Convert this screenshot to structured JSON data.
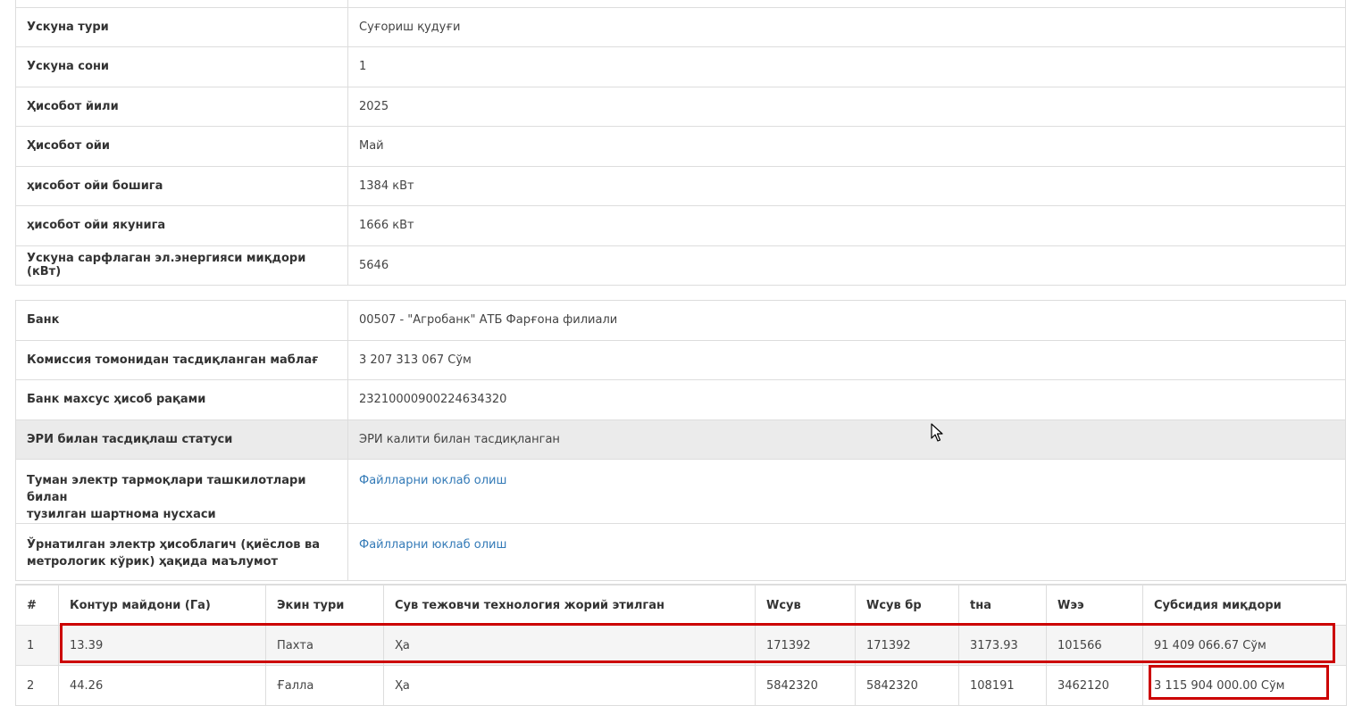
{
  "device_info": [
    {
      "label": "",
      "value": ""
    },
    {
      "label": "Ускуна тури",
      "value": "Суғориш қудуғи"
    },
    {
      "label": "Ускуна сони",
      "value": "1"
    },
    {
      "label": "Ҳисобот йили",
      "value": "2025"
    },
    {
      "label": "Ҳисобот ойи",
      "value": "Май"
    },
    {
      "label": "ҳисобот ойи бошига",
      "value": "1384 кВт"
    },
    {
      "label": "ҳисобот ойи якунига",
      "value": "1666 кВт"
    },
    {
      "label": "Ускуна сарфлаган эл.энергияси миқдори (кВт)",
      "value": "5646"
    }
  ],
  "bank_info": {
    "bank": {
      "label": "Банк",
      "value": "00507 - \"Агробанк\" АТБ Фарғона филиали"
    },
    "approved_amount": {
      "label": "Комиссия томонидан тасдиқланган маблағ",
      "value": "3 207 313 067 Сўм"
    },
    "account": {
      "label": "Банк махсус ҳисоб рақами",
      "value": "23210000900224634320"
    },
    "eri_status": {
      "label": "ЭРИ билан тасдиқлаш статуси",
      "value": "ЭРИ калити билан тасдиқланган"
    },
    "contract": {
      "label_line1": "Туман электр тармоқлари ташкилотлари билан",
      "label_line2": "тузилган шартнома нусхаси",
      "link": "Файлларни юклаб олиш"
    },
    "meter": {
      "label_line1": "Ўрнатилган электр ҳисоблагич (қиёслов ва",
      "label_line2": "метрологик кўрик) ҳақида маълумот",
      "link": "Файлларни юклаб олиш"
    }
  },
  "subsidy_table": {
    "headers": [
      "#",
      "Контур майдони (Га)",
      "Экин тури",
      "Сув тежовчи технология жорий этилган",
      "Wсув",
      "Wсув бр",
      "tна",
      "Wээ",
      "Субсидия миқдори"
    ],
    "rows": [
      [
        "1",
        "13.39",
        "Пахта",
        "Ҳа",
        "171392",
        "171392",
        "3173.93",
        "101566",
        "91 409 066.67 Сўм"
      ],
      [
        "2",
        "44.26",
        "Ғалла",
        "Ҳа",
        "5842320",
        "5842320",
        "108191",
        "3462120",
        "3 115 904 000.00 Сўм"
      ]
    ]
  },
  "colors": {
    "link": "#337ab7",
    "highlight_row": "#ebebeb",
    "annotation": "#cc0000",
    "border": "#dddddd"
  },
  "icons": [
    "mouse-cursor-icon"
  ]
}
